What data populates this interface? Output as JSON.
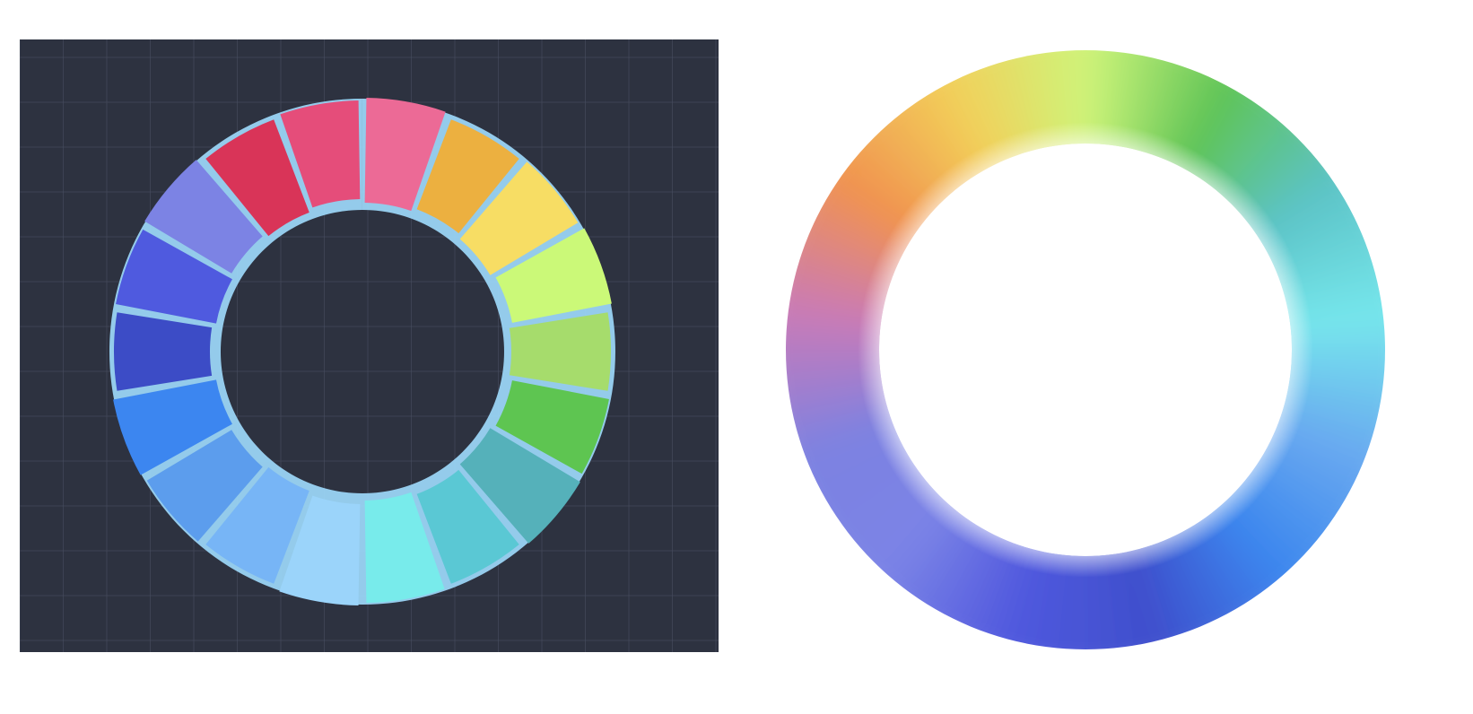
{
  "segmented_wheel": {
    "background": "#2d3240",
    "grid_color": "#4a5163",
    "separator_color": "#9ad4f4",
    "segments": [
      {
        "name": "pink-light",
        "color": "#ec6a96"
      },
      {
        "name": "orange",
        "color": "#ecb040"
      },
      {
        "name": "yellow",
        "color": "#f7dd64"
      },
      {
        "name": "yellow-green",
        "color": "#cbf978"
      },
      {
        "name": "light-green",
        "color": "#a6dc6c"
      },
      {
        "name": "green",
        "color": "#5ec551"
      },
      {
        "name": "teal",
        "color": "#55b1ba"
      },
      {
        "name": "cyan-teal",
        "color": "#5ac8d4"
      },
      {
        "name": "aqua",
        "color": "#78ebeb"
      },
      {
        "name": "pale-blue",
        "color": "#9bd4fa"
      },
      {
        "name": "sky-blue",
        "color": "#77b5f6"
      },
      {
        "name": "cornflower",
        "color": "#5c9ded"
      },
      {
        "name": "blue",
        "color": "#3c86f0"
      },
      {
        "name": "royal-blue",
        "color": "#3c4cc6"
      },
      {
        "name": "indigo",
        "color": "#4f5adf"
      },
      {
        "name": "periwinkle",
        "color": "#7c83e4"
      },
      {
        "name": "crimson",
        "color": "#d93458"
      },
      {
        "name": "rose",
        "color": "#e54d7a"
      }
    ]
  },
  "gradient_ring": {
    "stops": [
      "#cef47a",
      "#5fc456",
      "#5cc3c6",
      "#76e6ec",
      "#69a9f0",
      "#3b86ee",
      "#3f4fcc",
      "#5059de",
      "#7b83e6",
      "#7d82e1",
      "#c97ab7",
      "#f1934f",
      "#f2cf5a",
      "#cef47a"
    ]
  }
}
